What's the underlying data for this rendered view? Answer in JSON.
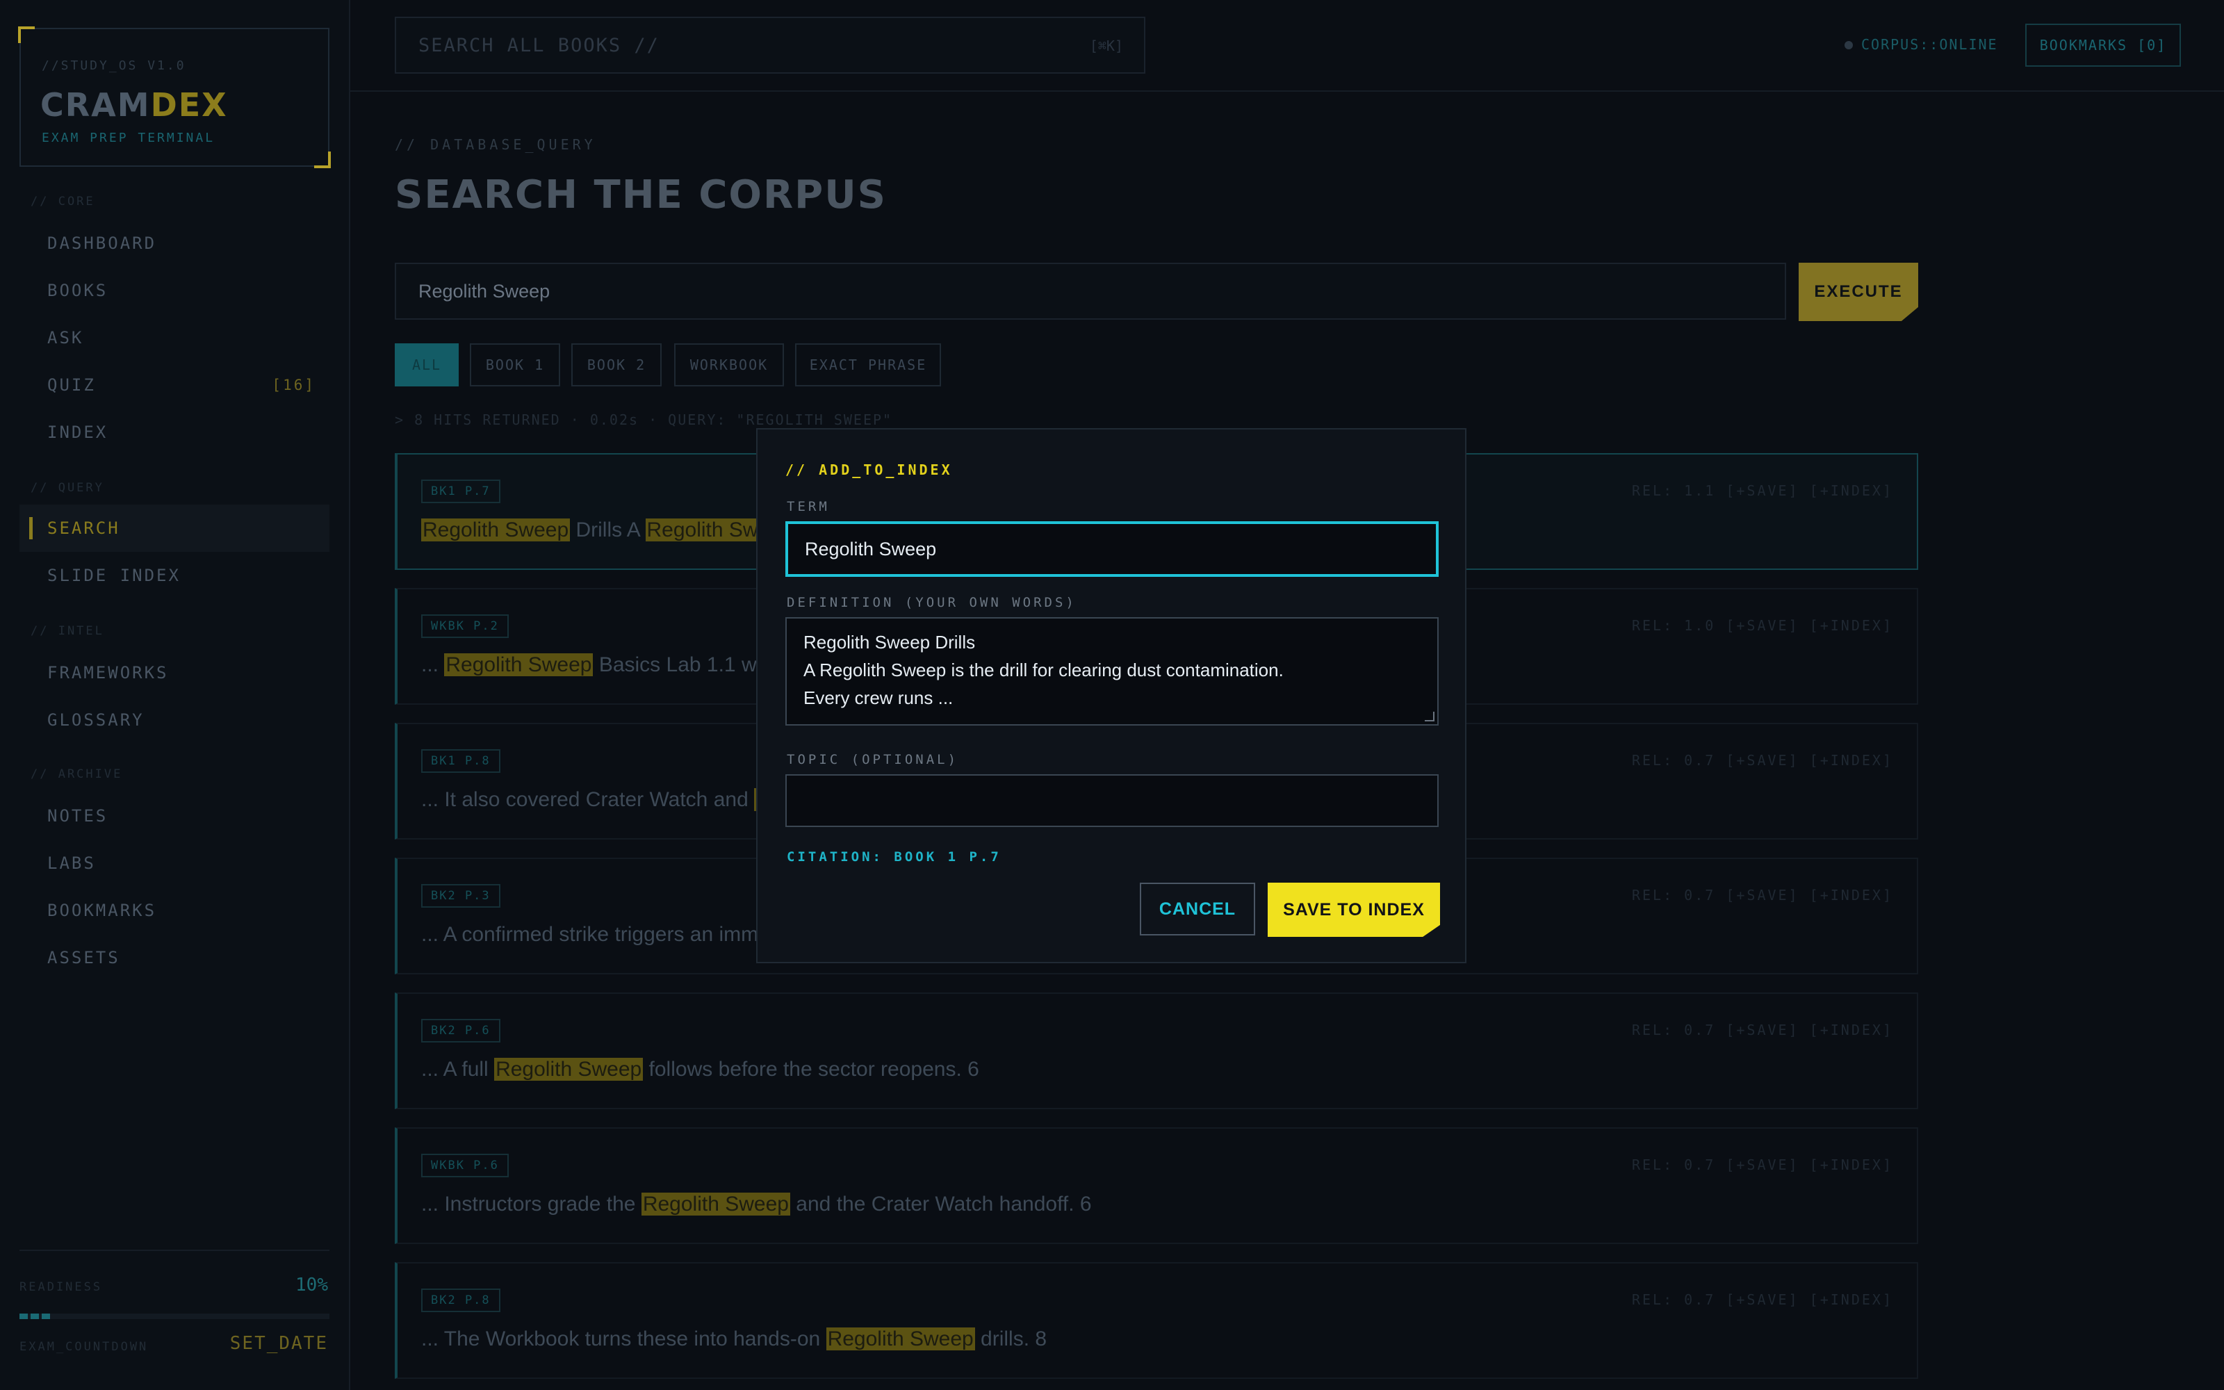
{
  "brand": {
    "version": "//STUDY_OS V1.0",
    "name_a": "CRAM",
    "name_b": "DEX",
    "tagline": "EXAM PREP TERMINAL"
  },
  "sidebar": {
    "sections": [
      {
        "label": "// CORE",
        "items": [
          {
            "label": "DASHBOARD"
          },
          {
            "label": "BOOKS"
          },
          {
            "label": "ASK"
          },
          {
            "label": "QUIZ",
            "count": "[16]"
          },
          {
            "label": "INDEX"
          }
        ]
      },
      {
        "label": "// QUERY",
        "items": [
          {
            "label": "SEARCH",
            "active": true
          },
          {
            "label": "SLIDE INDEX"
          }
        ]
      },
      {
        "label": "// INTEL",
        "items": [
          {
            "label": "FRAMEWORKS"
          },
          {
            "label": "GLOSSARY"
          }
        ]
      },
      {
        "label": "// ARCHIVE",
        "items": [
          {
            "label": "NOTES"
          },
          {
            "label": "LABS"
          },
          {
            "label": "BOOKMARKS"
          },
          {
            "label": "ASSETS"
          }
        ]
      }
    ],
    "readiness_label": "READINESS",
    "readiness_value": "10%",
    "readiness_fraction": 0.1,
    "countdown_label": "EXAM_COUNTDOWN",
    "countdown_value": "SET_DATE"
  },
  "topbar": {
    "search_placeholder": "SEARCH ALL BOOKS //",
    "search_shortcut": "[⌘K]",
    "status": "CORPUS::ONLINE",
    "bookmarks": "BOOKMARKS [0]"
  },
  "main": {
    "eyebrow": "// DATABASE_QUERY",
    "title": "SEARCH THE CORPUS",
    "query": "Regolith Sweep",
    "execute": "EXECUTE",
    "filters": [
      {
        "label": "ALL",
        "active": true
      },
      {
        "label": "BOOK 1"
      },
      {
        "label": "BOOK 2"
      },
      {
        "label": "WORKBOOK"
      },
      {
        "label": "EXACT PHRASE"
      }
    ],
    "hits": "> 8 HITS RETURNED · 0.02s · QUERY: \"REGOLITH SWEEP\"",
    "results": [
      {
        "ref": "BK1 P.7",
        "before": "",
        "mark": "Regolith Sweep",
        "after": " Drills A ",
        "mark2": "Regolith Swee",
        "after2": "",
        "meta": "REL: 1.1  [+SAVE]  [+INDEX]"
      },
      {
        "ref": "WKBK P.2",
        "before": "... ",
        "mark": "Regolith Sweep",
        "after": " Basics Lab 1.1 walks",
        "meta": "REL: 1.0  [+SAVE]  [+INDEX]"
      },
      {
        "ref": "BK1 P.8",
        "before": "... It also covered Crater Watch and ",
        "mark": "Re",
        "after": "",
        "meta": "REL: 0.7  [+SAVE]  [+INDEX]"
      },
      {
        "ref": "BK2 P.3",
        "before": "... A confirmed strike triggers an imme",
        "mark": "",
        "after": "",
        "meta": "REL: 0.7  [+SAVE]  [+INDEX]"
      },
      {
        "ref": "BK2 P.6",
        "before": "... A full ",
        "mark": "Regolith Sweep",
        "after": " follows before the sector reopens. 6",
        "meta": "REL: 0.7  [+SAVE]  [+INDEX]"
      },
      {
        "ref": "WKBK P.6",
        "before": "... Instructors grade the ",
        "mark": "Regolith Sweep",
        "after": " and the Crater Watch handoff. 6",
        "meta": "REL: 0.7  [+SAVE]  [+INDEX]"
      },
      {
        "ref": "BK2 P.8",
        "before": "... The Workbook turns these into hands-on ",
        "mark": "Regolith Sweep",
        "after": " drills. 8",
        "meta": "REL: 0.7  [+SAVE]  [+INDEX]"
      }
    ]
  },
  "modal": {
    "eyebrow": "// ADD_TO_INDEX",
    "term_label": "TERM",
    "term_value": "Regolith Sweep",
    "definition_label": "DEFINITION (YOUR OWN WORDS)",
    "definition_value": "Regolith Sweep Drills\nA Regolith Sweep is the drill for clearing dust contamination.\nEvery crew runs ...",
    "topic_label": "TOPIC (OPTIONAL)",
    "topic_value": "",
    "citation": "CITATION: BOOK 1 P.7",
    "cancel": "CANCEL",
    "save": "SAVE TO INDEX"
  },
  "colors": {
    "accent_cyan": "#1fc3d8",
    "accent_yellow": "#f0e11e",
    "background": "#0a0e14"
  }
}
